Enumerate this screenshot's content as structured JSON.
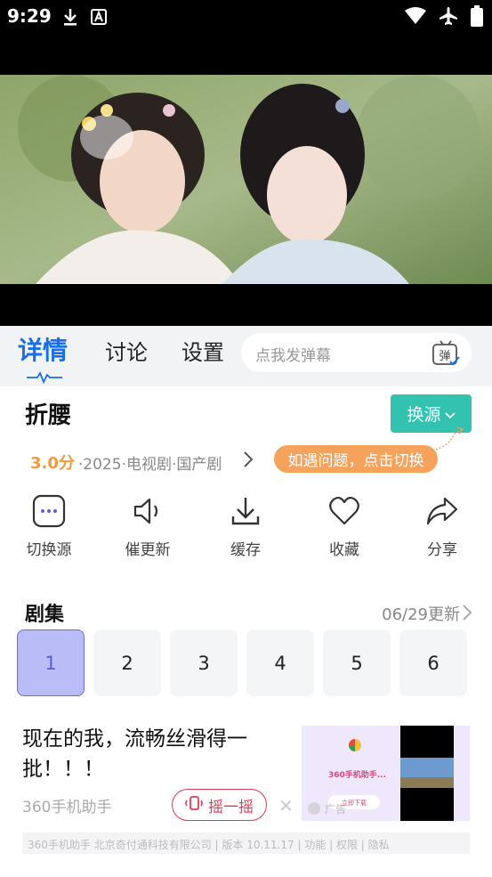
{
  "status": {
    "time": "9:29"
  },
  "tabs": {
    "details": "详情",
    "discuss": "讨论",
    "settings": "设置"
  },
  "danmu": {
    "placeholder": "点我发弹幕",
    "icon_label": "弹"
  },
  "show": {
    "title": "折腰",
    "switch_source": "换源",
    "score": "3.0分",
    "meta": "·2025·电视剧·国产剧",
    "tip": "如遇问题，点击切换"
  },
  "actions": [
    {
      "icon": "more-dots-icon",
      "label": "切换源"
    },
    {
      "icon": "speaker-icon",
      "label": "催更新"
    },
    {
      "icon": "download-icon",
      "label": "缓存"
    },
    {
      "icon": "heart-icon",
      "label": "收藏"
    },
    {
      "icon": "share-icon",
      "label": "分享"
    }
  ],
  "episodes": {
    "title": "剧集",
    "update": "06/29更新",
    "items": [
      "1",
      "2",
      "3",
      "4",
      "5",
      "6"
    ],
    "selected": "1"
  },
  "ad": {
    "title": "现在的我，流畅丝滑得一批！！！",
    "source": "360手机助手",
    "shake": "摇一摇",
    "close": "✕",
    "footer": "360手机助手 北京奇付通科技有限公司 | 版本 10.11.17 | 功能 | 权限 | 隐私",
    "image_text": "360手机助手...",
    "image_button": "立即下载",
    "image_badge": "广告"
  },
  "colors": {
    "accent": "#1a6fe8",
    "teal": "#33c2b0",
    "orange": "#f5a25d",
    "shake": "#e23a55",
    "episode_active": "#b9bcf6"
  }
}
